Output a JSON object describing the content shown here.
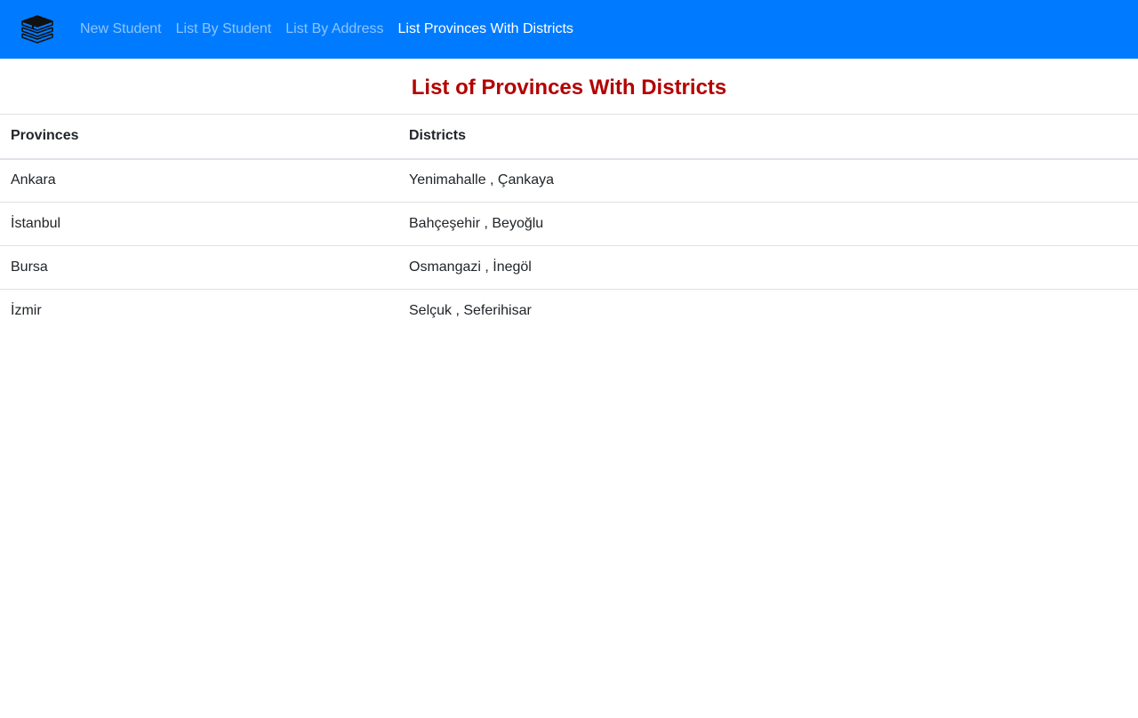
{
  "navbar": {
    "brand_icon": "books-stack-icon",
    "links": [
      {
        "label": "New Student",
        "active": false
      },
      {
        "label": "List By Student",
        "active": false
      },
      {
        "label": "List By Address",
        "active": false
      },
      {
        "label": "List Provinces With Districts",
        "active": true
      }
    ]
  },
  "page": {
    "title": "List of Provinces With Districts"
  },
  "table": {
    "headers": {
      "provinces": "Provinces",
      "districts": "Districts"
    },
    "rows": [
      {
        "province": "Ankara",
        "districts": "Yenimahalle , Çankaya"
      },
      {
        "province": "İstanbul",
        "districts": "Bahçeşehir , Beyoğlu"
      },
      {
        "province": "Bursa",
        "districts": "Osmangazi , İnegöl"
      },
      {
        "province": "İzmir",
        "districts": "Selçuk , Seferihisar"
      }
    ]
  },
  "colors": {
    "navbar_bg": "#007bff",
    "title_color": "#b30000",
    "active_link": "#ffffff",
    "inactive_link": "rgba(255,255,255,0.55)"
  }
}
